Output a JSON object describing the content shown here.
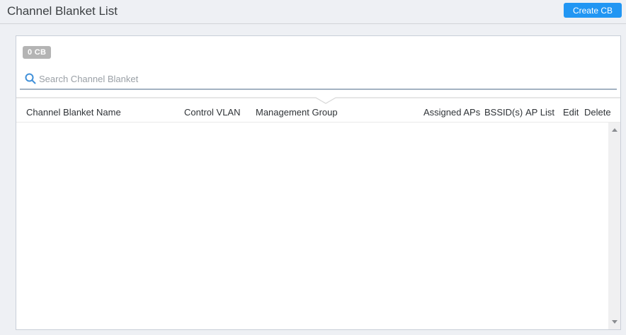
{
  "page": {
    "title": "Channel Blanket List"
  },
  "header": {
    "create_button_label": "Create CB"
  },
  "panel": {
    "count_badge": "0 CB",
    "search": {
      "icon": "search-icon",
      "placeholder": "Search Channel Blanket",
      "value": ""
    },
    "table": {
      "columns": [
        {
          "label": "Channel Blanket Name"
        },
        {
          "label": "Control VLAN"
        },
        {
          "label": "Management Group"
        },
        {
          "label": "Assigned APs"
        },
        {
          "label": "BSSID(s)"
        },
        {
          "label": "AP List"
        },
        {
          "label": "Edit"
        },
        {
          "label": "Delete"
        }
      ],
      "rows": []
    },
    "scrollbar": {
      "up_icon": "scroll-up-arrow-icon",
      "down_icon": "scroll-down-arrow-icon"
    }
  },
  "colors": {
    "accent_blue": "#2196f3",
    "badge_gray": "#b4b4b4",
    "search_underline": "#a3b2c2",
    "page_background": "#eef0f4"
  }
}
